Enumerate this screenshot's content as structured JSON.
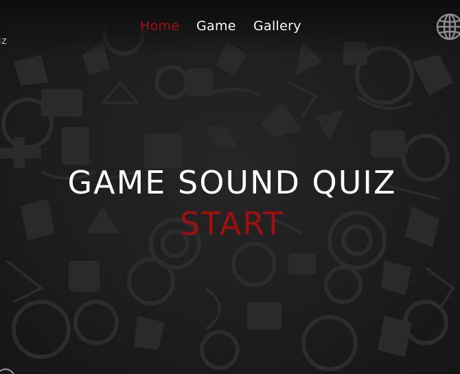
{
  "logo": {
    "text": "IZ"
  },
  "nav": {
    "items": [
      {
        "label": "Home",
        "active": true
      },
      {
        "label": "Game",
        "active": false
      },
      {
        "label": "Gallery",
        "active": false
      }
    ]
  },
  "language": {
    "icon": "globe-icon"
  },
  "hero": {
    "title": "GAME SOUND QUIZ",
    "start_label": "START"
  },
  "colors": {
    "accent": "#a01212",
    "background": "#1b1b1b",
    "text": "#ffffff",
    "pattern": "#2e2e2e"
  }
}
